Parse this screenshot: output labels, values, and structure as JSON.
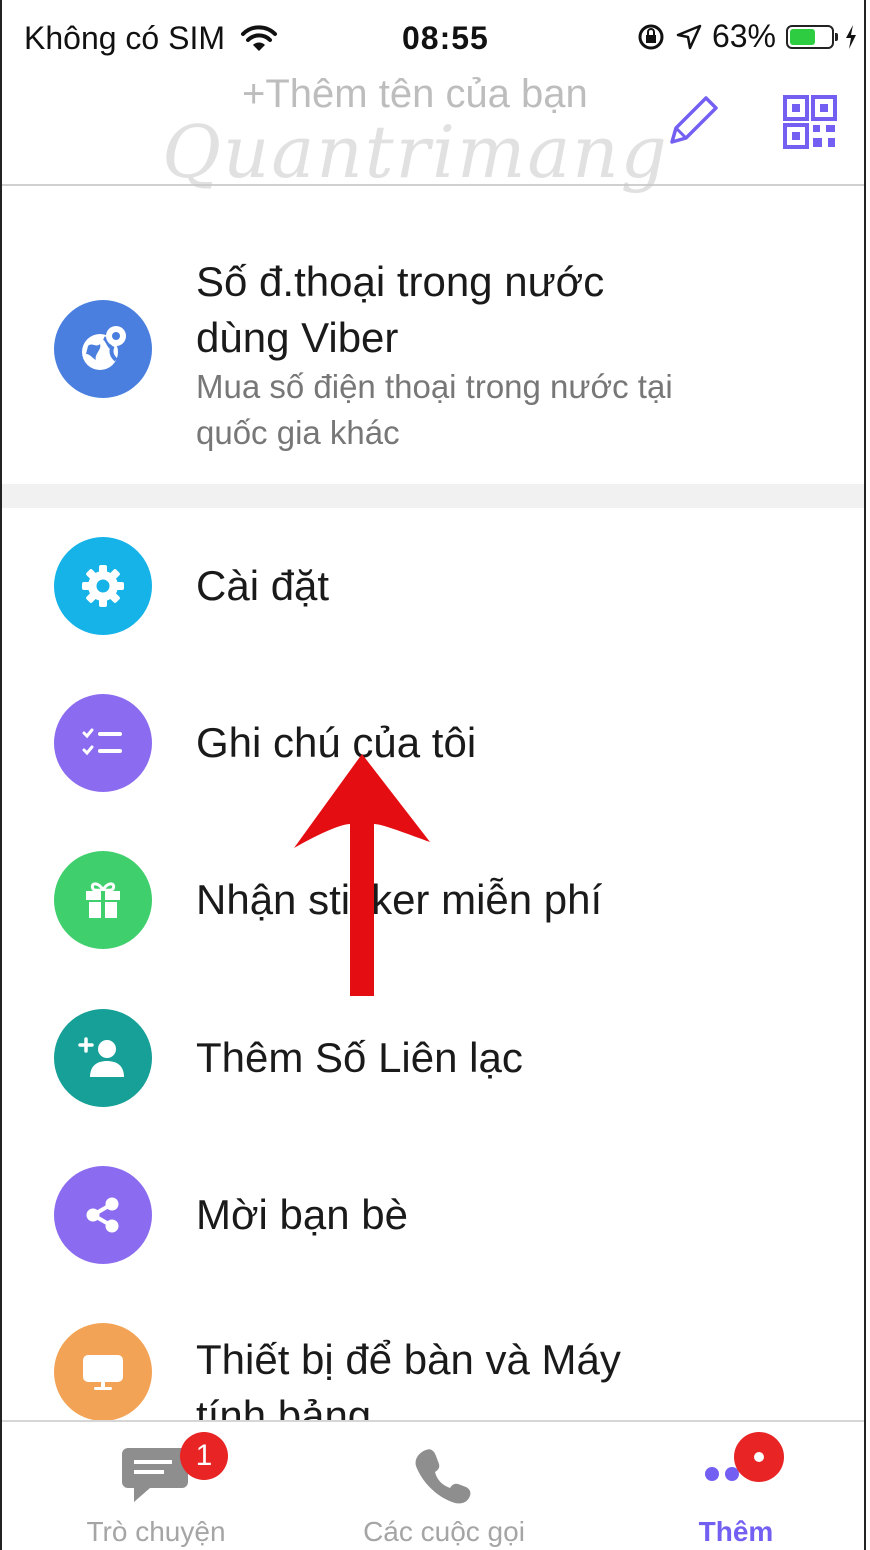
{
  "status_bar": {
    "carrier": "Không có SIM",
    "time": "08:55",
    "battery": "63%",
    "battery_level": 0.63
  },
  "header": {
    "add_name": "+Thêm tên của bạn",
    "watermark": "Quantrimang"
  },
  "viber_out": {
    "title_line1": "Số đ.thoại trong nước",
    "title_line2": "dùng Viber",
    "sub_line1": "Mua số điện thoại trong nước tại",
    "sub_line2": "quốc gia khác",
    "icon": "globe-pin-icon",
    "color": "#4a7fe0"
  },
  "menu": [
    {
      "label": "Cài đặt",
      "icon": "gear-icon",
      "color": "#16b3e8"
    },
    {
      "label": "Ghi chú của tôi",
      "icon": "checklist-icon",
      "color": "#8b6cf0"
    },
    {
      "label": "Nhận sticker miễn phí",
      "icon": "gift-icon",
      "color": "#3fcf6c"
    },
    {
      "label": "Thêm Số Liên lạc",
      "icon": "add-contact-icon",
      "color": "#16a097"
    },
    {
      "label": "Mời bạn bè",
      "icon": "share-icon",
      "color": "#8b6cf0"
    }
  ],
  "desktop_item": {
    "title_line1": "Thiết bị để bàn và Máy",
    "title_line2": "tính bảng",
    "icon": "monitor-icon",
    "color": "#f2a356"
  },
  "tabs": [
    {
      "label": "Trò chuyện",
      "icon": "chat-icon",
      "badge": "1"
    },
    {
      "label": "Các cuộc gọi",
      "icon": "phone-icon"
    },
    {
      "label": "Thêm",
      "icon": "more-dots-icon",
      "active": true
    }
  ],
  "accent_color": "#7360f2"
}
